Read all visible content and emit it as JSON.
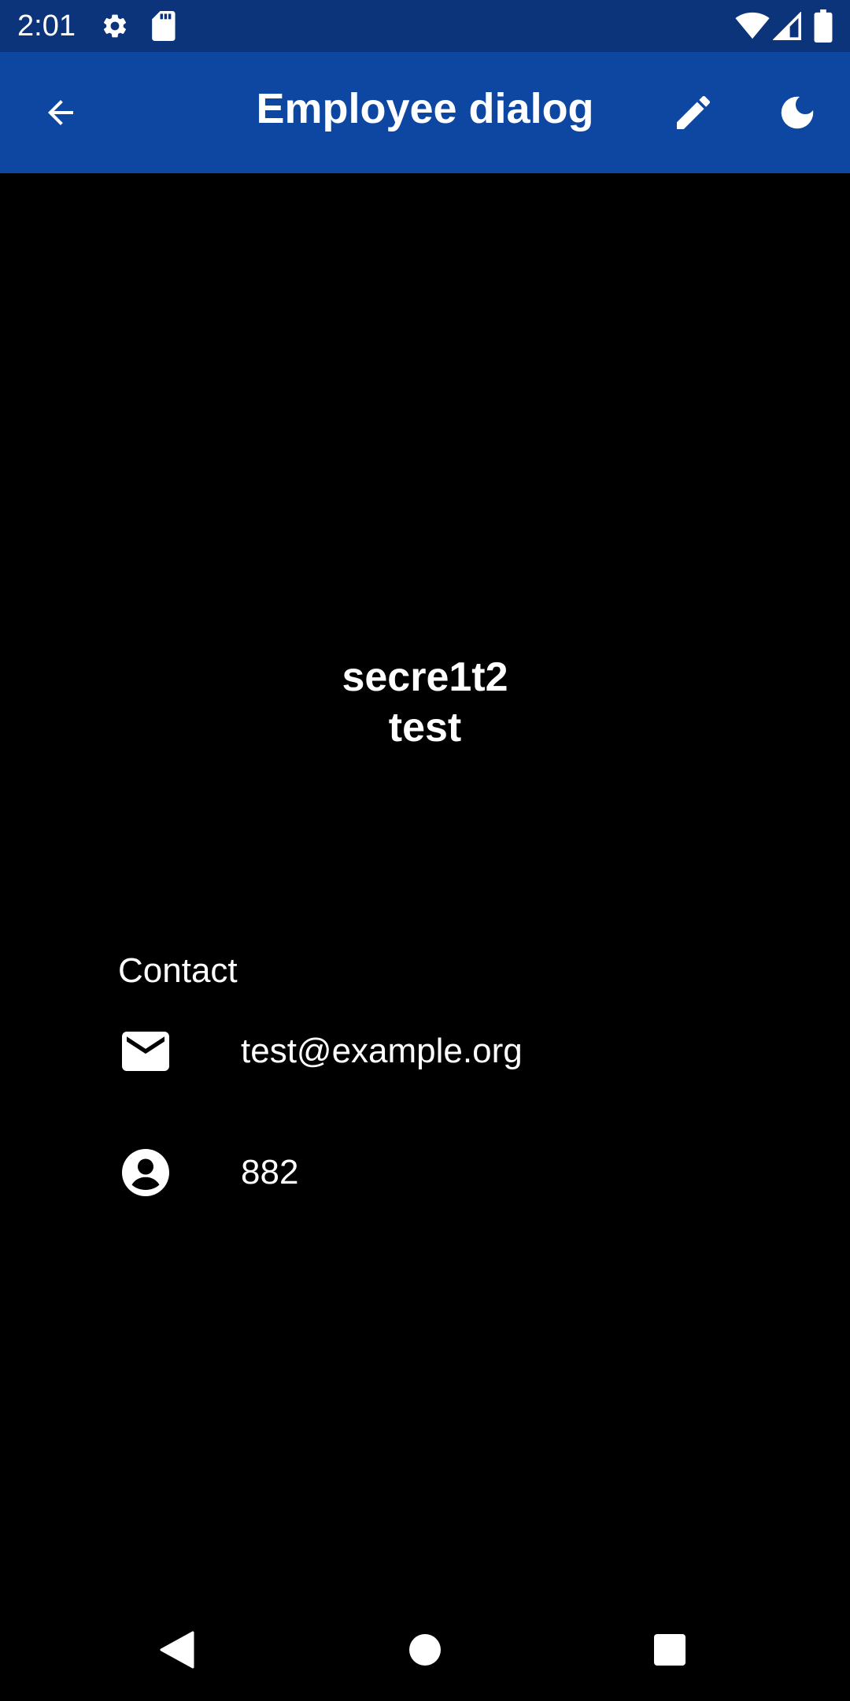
{
  "status_bar": {
    "time": "2:01",
    "icons": [
      "gear-icon",
      "sd-card-icon",
      "wifi-icon",
      "signal-icon",
      "battery-icon"
    ],
    "background": "#0b347a"
  },
  "app_bar": {
    "title": "Employee dialog",
    "background": "#0d47a1",
    "actions": [
      "back-arrow-icon",
      "edit-pencil-icon",
      "dark-mode-moon-icon"
    ]
  },
  "employee": {
    "first_name": "secre1t2",
    "last_name": "test"
  },
  "contact": {
    "section_title": "Contact",
    "items": [
      {
        "icon": "email-icon",
        "value": "test@example.org"
      },
      {
        "icon": "account-circle-icon",
        "value": "882"
      }
    ]
  },
  "nav_bar": {
    "buttons": [
      "back-triangle-icon",
      "home-circle-icon",
      "recents-square-icon"
    ]
  },
  "colors": {
    "background": "#000000",
    "text": "#ffffff"
  }
}
